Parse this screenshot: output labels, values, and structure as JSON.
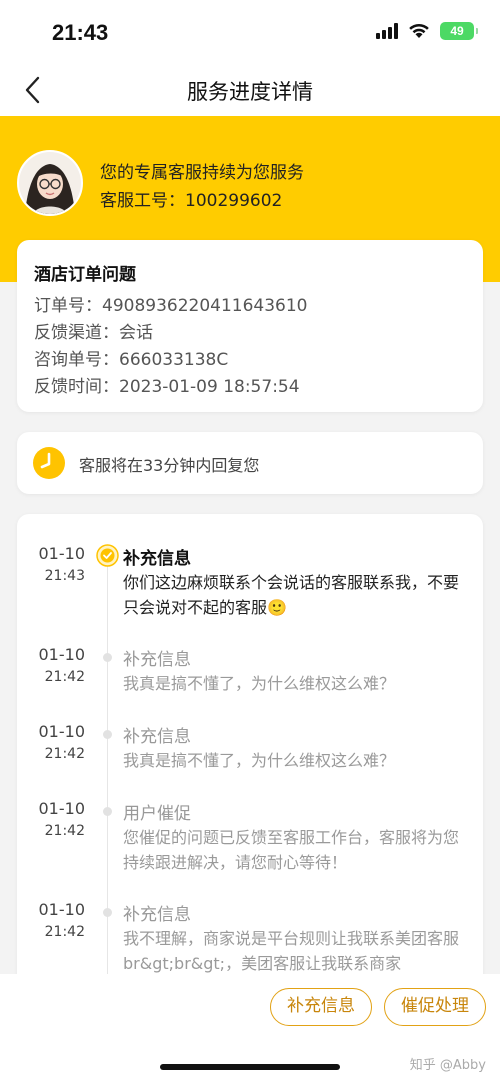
{
  "status_bar": {
    "time": "21:43",
    "battery": "49"
  },
  "nav": {
    "title": "服务进度详情"
  },
  "agent": {
    "line1": "您的专属客服持续为您服务",
    "id_label": "客服工号：",
    "id_value": "100299602"
  },
  "order": {
    "title": "酒店订单问题",
    "rows": [
      {
        "label": "订单号：",
        "value": "4908936220411643610"
      },
      {
        "label": "反馈渠道：",
        "value": "会话"
      },
      {
        "label": "咨询单号：",
        "value": "666033138C"
      },
      {
        "label": "反馈时间：",
        "value": "2023-01-09 18:57:54"
      }
    ]
  },
  "wait": {
    "text": "客服将在33分钟内回复您"
  },
  "timeline": [
    {
      "date": "01-10",
      "time": "21:43",
      "title": "补充信息",
      "body": "你们这边麻烦联系个会说话的客服联系我，不要只会说对不起的客服🙂",
      "active": true
    },
    {
      "date": "01-10",
      "time": "21:42",
      "title": "补充信息",
      "body": "我真是搞不懂了，为什么维权这么难？",
      "active": false
    },
    {
      "date": "01-10",
      "time": "21:42",
      "title": "补充信息",
      "body": "我真是搞不懂了，为什么维权这么难？",
      "active": false
    },
    {
      "date": "01-10",
      "time": "21:42",
      "title": "用户催促",
      "body": "您催促的问题已反馈至客服工作台，客服将为您持续跟进解决，请您耐心等待！",
      "active": false
    },
    {
      "date": "01-10",
      "time": "21:42",
      "title": "补充信息",
      "body": "我不理解，商家说是平台规则让我联系美团客服br&gt;br&gt;，美团客服让我联系商家",
      "active": false
    }
  ],
  "actions": {
    "supplement": "补充信息",
    "urge": "催促处理"
  },
  "watermark": "知乎 @Abby",
  "colors": {
    "brand_yellow": "#ffcc00",
    "button_border": "#e2a215",
    "button_text": "#c8860c",
    "battery_green": "#4cd964"
  }
}
